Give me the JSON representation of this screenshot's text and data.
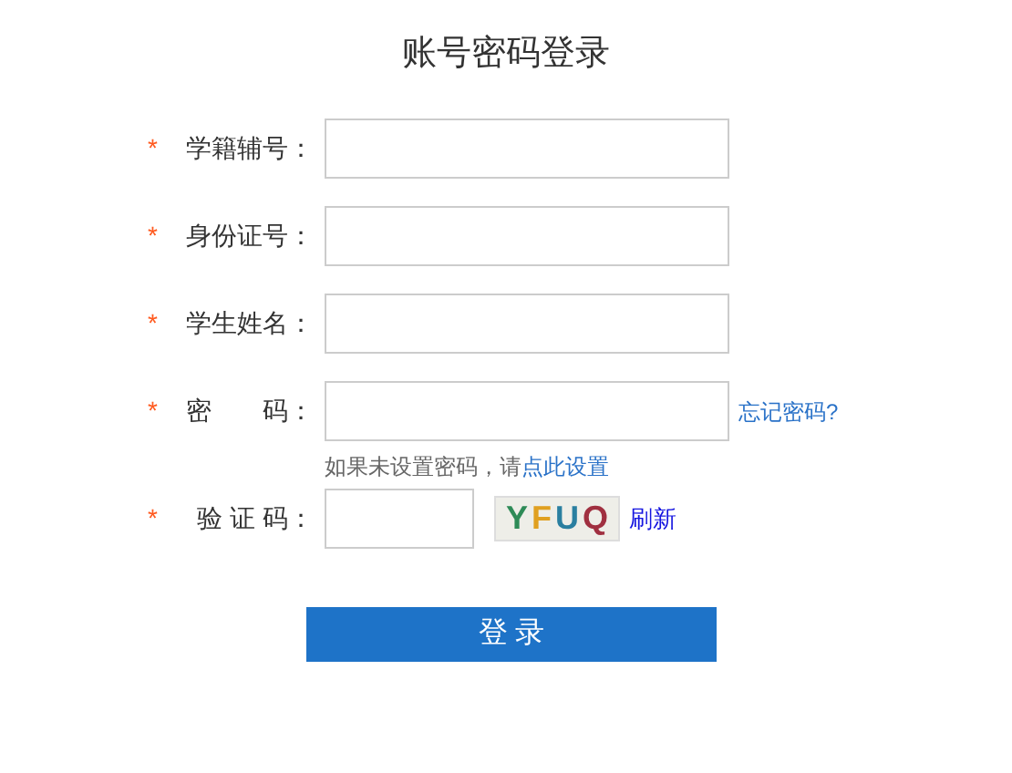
{
  "title": "账号密码登录",
  "fields": [
    {
      "kind": "text",
      "label": "学籍辅号：",
      "required": true
    },
    {
      "kind": "text",
      "label": "身份证号：",
      "required": true
    },
    {
      "kind": "text",
      "label": "学生姓名：",
      "required": true
    },
    {
      "kind": "password",
      "label": "密　　码：",
      "required": true,
      "link": "忘记密码?",
      "hint": "如果未设置密码，请",
      "hint_link": "点此设置"
    },
    {
      "kind": "captcha",
      "label": "验 证 码：",
      "required": true,
      "captcha": "YFUQ",
      "link": "刷新"
    }
  ],
  "required_mark": "*",
  "submit": "登 录"
}
